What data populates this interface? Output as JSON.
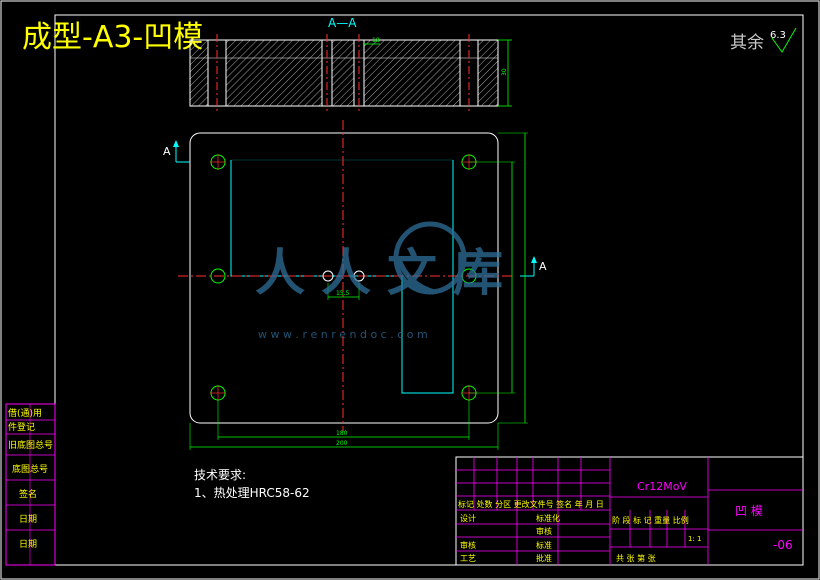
{
  "title": "成型-A3-凹模",
  "section_label": "A—A",
  "section_marker": "A",
  "surface_finish": {
    "prefix": "其余",
    "value": "6.3"
  },
  "dimensions": {
    "hole_spacing": "15.5",
    "hole_center_width": "180",
    "overall_width": "200",
    "top_small": "18",
    "side_thickness": "30"
  },
  "tech_requirements": {
    "heading": "技术要求:",
    "items": [
      "1、热处理HRC58-62"
    ]
  },
  "left_strip": [
    "借(通)用",
    "件登记",
    "旧底图总号",
    "底图总号",
    "签名",
    "日期",
    "日期"
  ],
  "title_block": {
    "material": "Cr12MoV",
    "part_name": "凹  模",
    "drawing_number": "-06",
    "scale": "1: 1",
    "header_row": "标记 处数  分区  更改文件号 签名  年 月 日",
    "stage_row": "阶 段 标 记   重量  比例",
    "row_labels": [
      "设计",
      "标准化",
      "审核",
      "工艺",
      "审核",
      "标准",
      "批准"
    ],
    "sheet_row": "共   张  第   张"
  },
  "watermark": {
    "text": "人人文库",
    "url": "w w w . r e n r e n d o c . c o m"
  },
  "colors": {
    "background": "#000000",
    "frame": "#ffffff",
    "title": "#ffff00",
    "center_line": "#ff3030",
    "dimension": "#00ff00",
    "cyan": "#00ffff",
    "magenta": "#ff00ff",
    "watermark": "#2e6f9a"
  }
}
